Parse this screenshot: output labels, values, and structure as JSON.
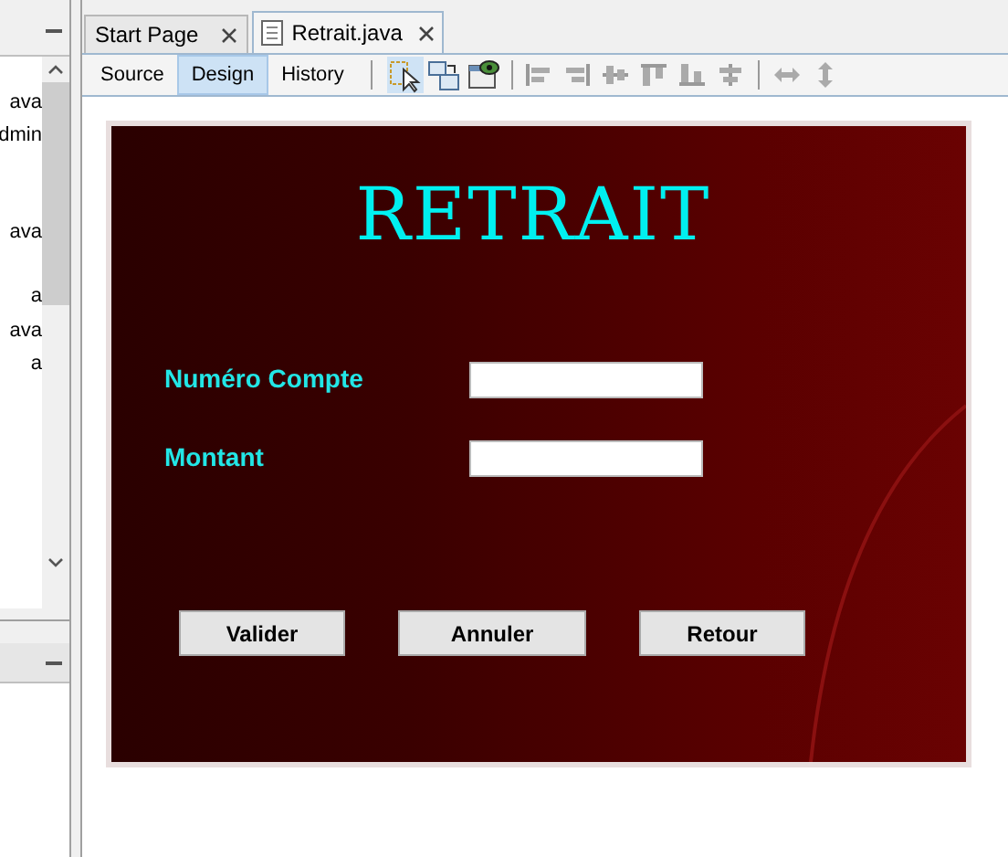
{
  "project_panel": {
    "items": [
      "ava",
      "dmin",
      "ava",
      "a",
      "ava",
      "a"
    ]
  },
  "editor_tabs": [
    {
      "label": "Start Page",
      "selected": false,
      "has_icon": false
    },
    {
      "label": "Retrait.java",
      "selected": true,
      "has_icon": true
    }
  ],
  "view_tabs": [
    {
      "label": "Source",
      "selected": false
    },
    {
      "label": "Design",
      "selected": true
    },
    {
      "label": "History",
      "selected": false
    }
  ],
  "form": {
    "title": "RETRAIT",
    "fields": [
      {
        "label": "Numéro Compte"
      },
      {
        "label": "Montant"
      }
    ],
    "buttons": [
      "Valider",
      "Annuler",
      "Retour"
    ]
  }
}
